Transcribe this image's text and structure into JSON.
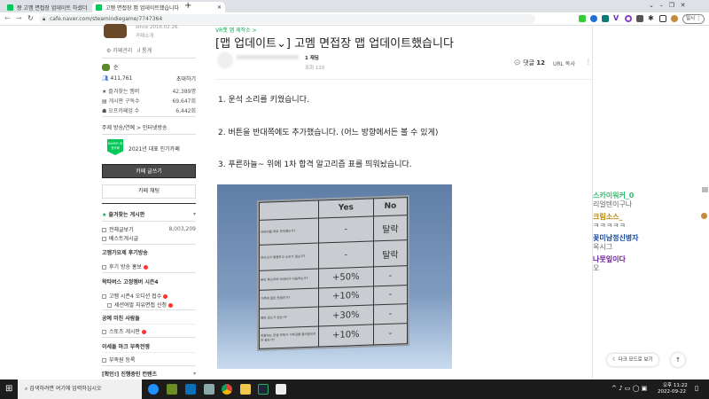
{
  "browser": {
    "tabs": [
      {
        "label": "짱 고멤 면접장 업데이트 하셨더"
      },
      {
        "label": "고멤 면접장 맵 업데이트했습니다"
      }
    ],
    "new_tab": "+",
    "url": "cafe.naver.com/steamindiegame/7747364",
    "profile_label": "일시"
  },
  "sidebar": {
    "cafe_since": "since 2016.02.26.",
    "cafe_intro": "카페소개",
    "manage": "카페관리",
    "stats": "통계",
    "level": "순",
    "members": "411,761",
    "invite": "초대하기",
    "stats_rows": [
      {
        "label": "즐겨찾는 멤버",
        "value": "42,389명"
      },
      {
        "label": "게시판 구독수",
        "value": "69,647회"
      },
      {
        "label": "오프카페업 수",
        "value": "6,442회"
      }
    ],
    "topic": "주제  방송/연예 > 인터넷방송",
    "badge_text": "NAVER 대표카페",
    "badge_label": "2021년 대표 인기카페",
    "write_button": "카페 글쓰기",
    "chat_button": "카페 채팅",
    "fav_boards": "즐겨찾는 게시판",
    "all_posts": "전체글보기",
    "all_count": "8,003,209",
    "best": "베스트게시글",
    "sections": [
      {
        "title": "고멤가요제 후기방송",
        "items": [
          "후기 방송 홍보"
        ]
      },
      {
        "title": "왁타버스 고정멤버 시즌4",
        "items": [
          "고멤 시즌4 오디션 접수",
          "세션여멀 지유면접 신청"
        ]
      },
      {
        "title": "공예 미친 사람들",
        "items": [
          "스토츠 게시판"
        ]
      },
      {
        "title": "이세돌 마크 부족전쟁",
        "items": [
          "부족원 등록"
        ]
      },
      {
        "title": "[확인!] 진행중인 컨텐츠",
        "items": []
      }
    ]
  },
  "article": {
    "board_link": "VR챗 맵 제작소 >",
    "title": "[맵 업데이트⌄] 고멤 면접장 맵 업데이트했습니다",
    "author_level": "1 재딤",
    "views": "조회 110",
    "comments_label": "댓글",
    "comments_count": "12",
    "url_copy": "URL 복사",
    "lines": [
      "1. 운석 소리를 키웠습니다.",
      "2. 버튼을 반대쪽에도 추가했습니다. (어느 방향에서든 볼 수 있게)",
      "3. 푸른하늘~ 위에 1차 합격 알고리즘 표를 띄워놨습니다."
    ],
    "image_table": {
      "headers": [
        "",
        "Yes",
        "No"
      ],
      "rows": [
        [
          "아바타를 따로 준비했는가?",
          "-",
          "탈락"
        ],
        [
          "마이크가 멀쩡하고 소리가 없는가?",
          "-",
          "탈락"
        ],
        [
          "본인 목소리와 아바타가 어울리는가?",
          "+50%",
          "-"
        ],
        [
          "기존에 없던 컨셉인가?",
          "+10%",
          "-"
        ],
        [
          "벤트 센스가 있는가?",
          "+30%",
          "-"
        ],
        [
          "지향하는 컨셉 자체가 거부감을 불러일으키지 않는가?",
          "+10%",
          "-"
        ]
      ]
    }
  },
  "chat": [
    {
      "name": "스카이워커_0",
      "msg": "리얼텐이구나",
      "color": "#2fbf71"
    },
    {
      "name": "크림소스_",
      "msg": "ㅋㅋㅋㅋㅋ",
      "color": "#b8860b"
    },
    {
      "name": "꽃미남정신병자",
      "msg": "옥시그",
      "color": "#1a4fa3"
    },
    {
      "name": "나뭇잎이다",
      "msg": "오",
      "color": "#6a1b9a"
    }
  ],
  "floating": {
    "dark_mode": "다크 모드로 보기",
    "top": "↑"
  },
  "taskbar": {
    "search_placeholder": "검색하려면 여기에 입력하십시오",
    "time": "오후 11:22",
    "date": "2022-09-22"
  }
}
